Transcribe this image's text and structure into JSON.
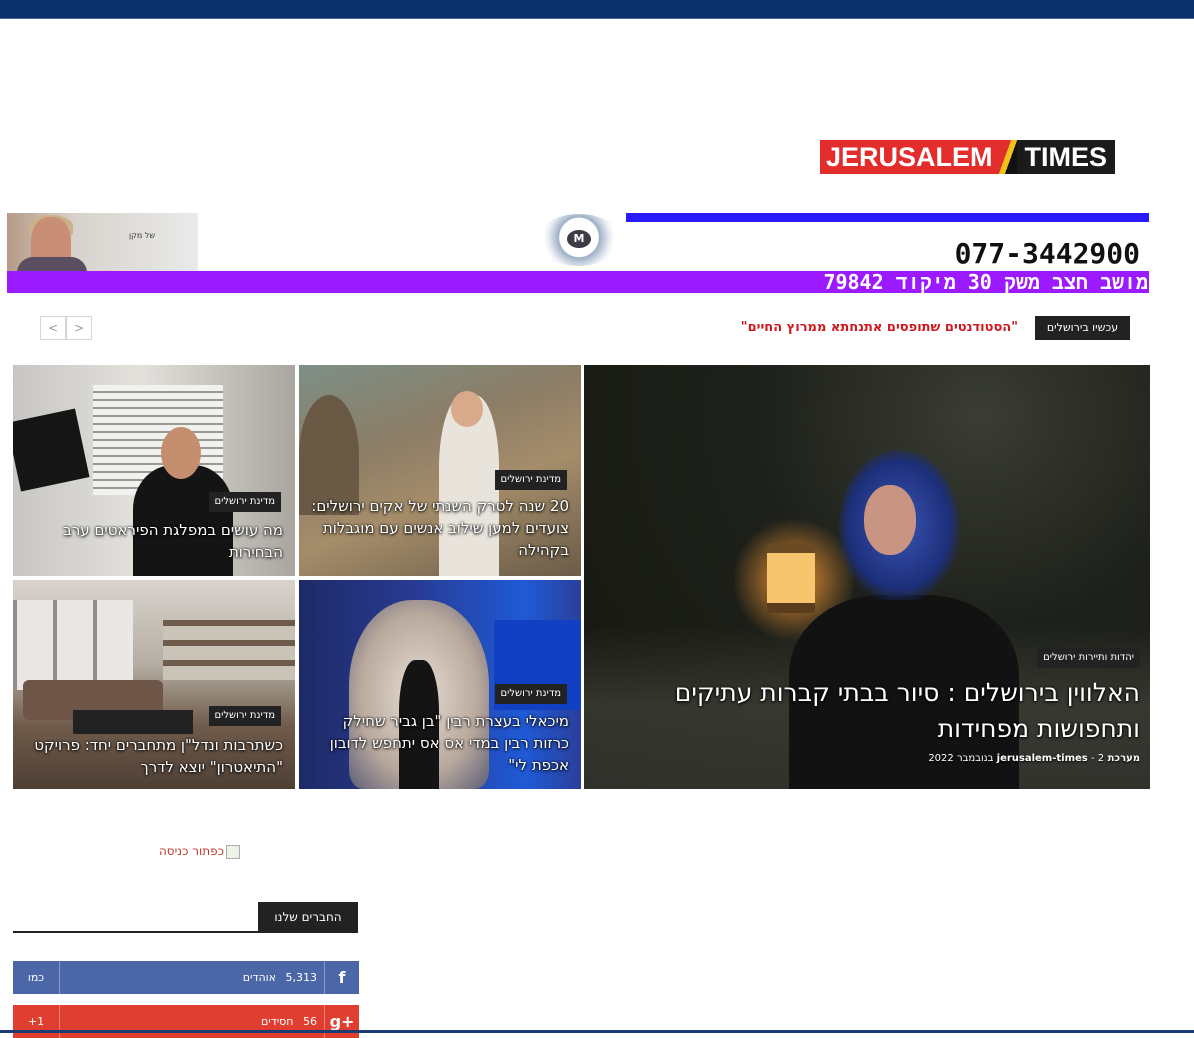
{
  "logo": {
    "part1": "JERUSALEM",
    "part2": "TIMES"
  },
  "banner": {
    "phone": "077-3442900",
    "address": "מושב חצב משק 30 מיקוד 79842",
    "video_sign": "של מקן",
    "badge_letter": "M"
  },
  "ticker": {
    "label": "עכשיו בירושלים",
    "text": "\"הסטודנטים שתופסים אתנחתא ממרוץ החיים\"",
    "prev": "<",
    "next": ">"
  },
  "grid": {
    "main": {
      "category": "יהדות ותיירות ירושלים",
      "title": "האלווין בירושלים : סיור בבתי קברות עתיקים ותחפושות מפחידות",
      "author": "מערכת jerusalem-times",
      "date": "- 2 בנובמבר 2022"
    },
    "tile_a": {
      "category": "מדינת ירושלים",
      "title": "20 שנה לטרק השנתי של אקים ירושלים: צועדים למען שילוב אנשים עם מוגבלות בקהילה"
    },
    "tile_b": {
      "category": "מדינת ירושלים",
      "title": "מה עושים במפלגת הפיראטים ערב הבחירות"
    },
    "tile_c": {
      "category": "מדינת ירושלים",
      "title": "מיכאלי בעצרת רבין \"בן גביר שחילק כרזות רבין במדי אס אס יתחפש לדובון אכפת לי\""
    },
    "tile_d": {
      "category": "מדינת ירושלים",
      "title": "כשתרבות ונדל\"ן מתחברים יחד: פרויקט \"התיאטרון\" יוצא לדרך"
    }
  },
  "sidebar": {
    "cover_image_alt": "כפתור כניסה",
    "friends_heading": "החברים שלנו",
    "facebook": {
      "count": "5,313",
      "label": "אוהדים",
      "button": "כמו",
      "icon": "f"
    },
    "googleplus": {
      "count": "56",
      "label": "חסידים",
      "button": "+1",
      "icon": "g+"
    }
  },
  "colors": {
    "accent_blue": "#2a1bff",
    "accent_purple": "#9c1aff",
    "headline_red": "#d0191f",
    "brand_red": "#e32c2c",
    "topbar": "#0b2f6b"
  }
}
